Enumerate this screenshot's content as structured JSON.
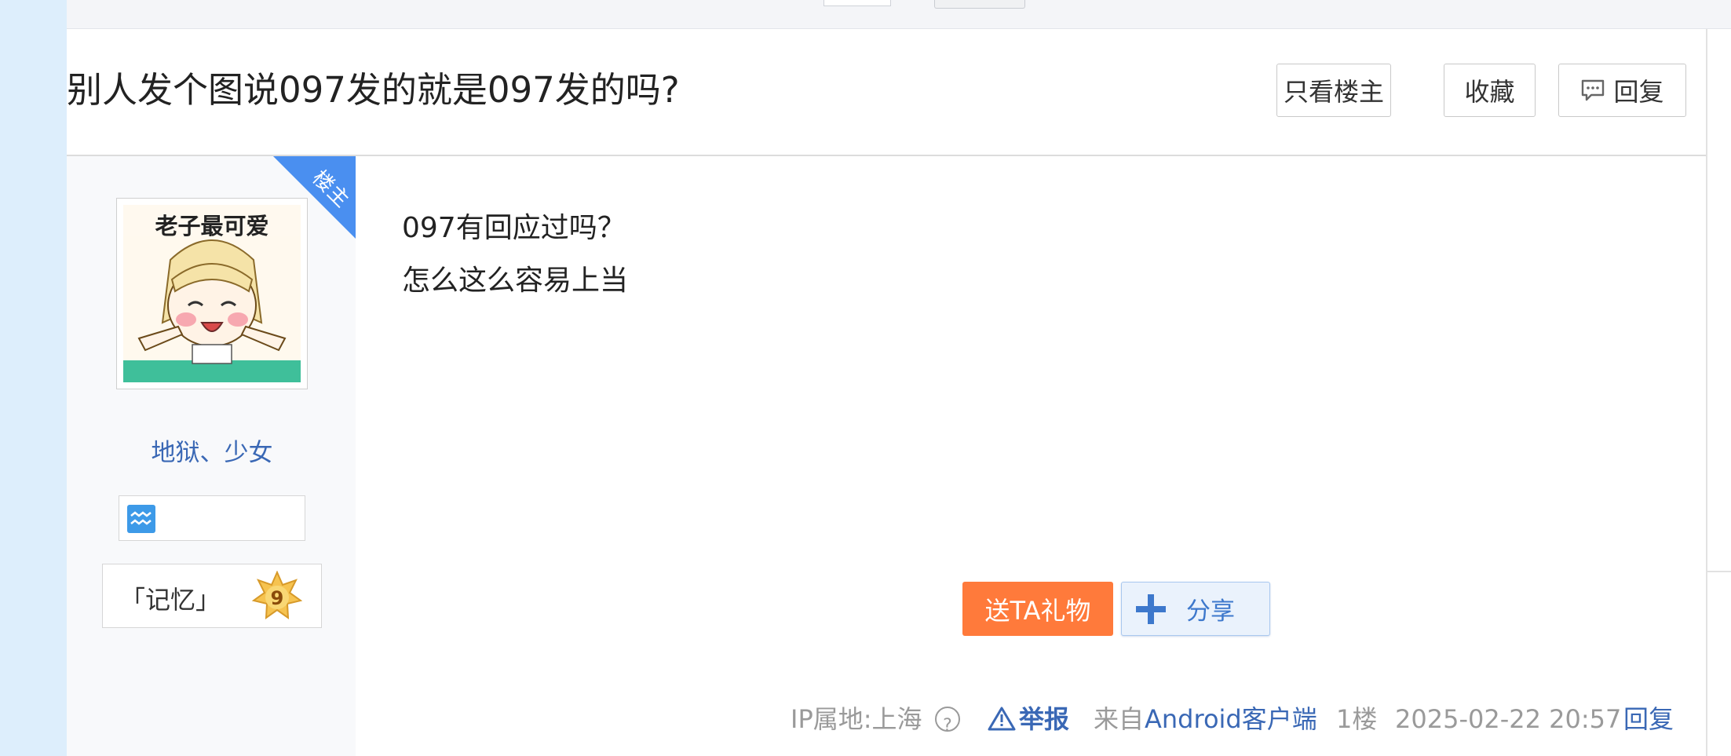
{
  "thread": {
    "title": "别人发个图说097发的就是097发的吗?",
    "actions": {
      "only_op_label": "只看楼主",
      "favorite_label": "收藏",
      "reply_label": "回复"
    }
  },
  "post": {
    "op_badge": "楼主",
    "author": {
      "avatar_caption": "老子最可爱",
      "username": "地狱、少女",
      "badge_icon": "aquarius-icon",
      "level_name": "「记忆」",
      "level_number": "9"
    },
    "content_lines": [
      "097有回应过吗？",
      "怎么这么容易上当"
    ],
    "gift_label": "送TA礼物",
    "share_label": "分享",
    "meta": {
      "ip_location": "IP属地:上海",
      "help_symbol": "?",
      "report_label": "举报",
      "source_prefix": "来自",
      "source_client": "Android客户端",
      "floor": "1楼",
      "timestamp": "2025-02-22 20:57",
      "reply_label": "回复"
    }
  },
  "colors": {
    "accent_blue": "#3a68b5",
    "op_badge_blue": "#4a8ff0",
    "gift_orange": "#ff7a3b",
    "page_background": "#ddeefc"
  }
}
